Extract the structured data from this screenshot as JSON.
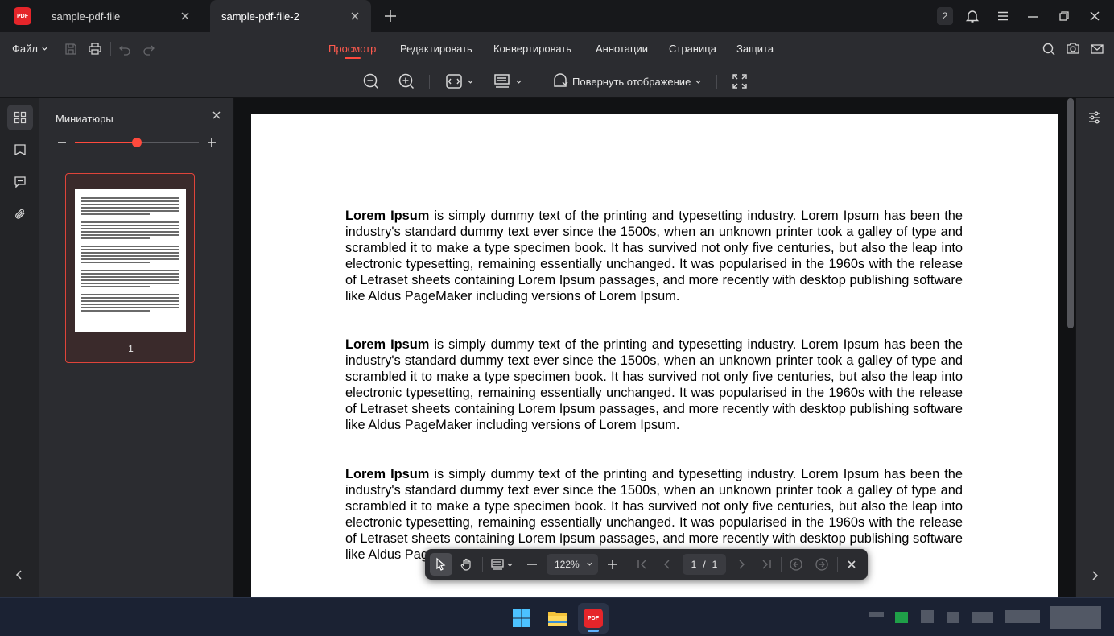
{
  "tabs": [
    {
      "label": "sample-pdf-file",
      "active": false
    },
    {
      "label": "sample-pdf-file-2",
      "active": true
    }
  ],
  "app_logo_text": "PDF",
  "notification_count": "2",
  "menu": {
    "file_label": "Файл",
    "tabs": [
      "Просмотр",
      "Редактировать",
      "Конвертировать",
      "Аннотации",
      "Страница",
      "Защита"
    ],
    "active_tab": "Просмотр"
  },
  "toolbar": {
    "rotate_label": "Повернуть отображение"
  },
  "thumbnails": {
    "title": "Миниатюры",
    "zoom_fraction": 0.5,
    "pages": [
      {
        "number": "1"
      }
    ]
  },
  "document": {
    "paragraphs": [
      {
        "bold": "Lorem Ipsum",
        "text": " is simply dummy text of the printing and typesetting industry. Lorem Ipsum has been the industry's standard dummy text ever since the 1500s, when an unknown printer took a galley of type and scrambled it to make a type specimen book. It has survived not only five centuries, but also the leap into electronic typesetting, remaining essentially unchanged. It was popularised in the 1960s with the release of Letraset sheets containing Lorem Ipsum passages, and more recently with desktop publishing software like Aldus PageMaker including versions of Lorem Ipsum."
      },
      {
        "bold": "Lorem Ipsum",
        "text": " is simply dummy text of the printing and typesetting industry. Lorem Ipsum has been the industry's standard dummy text ever since the 1500s, when an unknown printer took a galley of type and scrambled it to make a type specimen book. It has survived not only five centuries, but also the leap into electronic typesetting, remaining essentially unchanged. It was popularised in the 1960s with the release of Letraset sheets containing Lorem Ipsum passages, and more recently with desktop publishing software like Aldus PageMaker including versions of Lorem Ipsum."
      },
      {
        "bold": "Lorem Ipsum",
        "text": " is simply dummy text of the printing and typesetting industry. Lorem Ipsum has been the industry's standard dummy text ever since the 1500s, when an unknown printer took a galley of type and scrambled it to make a type specimen book. It has survived not only five centuries, but also the leap into electronic typesetting, remaining essentially unchanged. It was popularised in the 1960s with the release of Letraset sheets containing Lorem Ipsum passages, and more recently with desktop publishing software like Aldus PageMaker including versions of Lorem Ipsum."
      }
    ]
  },
  "floatbar": {
    "zoom": "122%",
    "current_page": "1",
    "page_separator": "/",
    "total_pages": "1"
  },
  "colors": {
    "accent": "#ff4a3d",
    "panel_bg": "#2b2c30",
    "doc_bg": "#111214",
    "titlebar_bg": "#17181b"
  },
  "icons": [
    "pdf-logo",
    "close-icon",
    "plus-icon",
    "bell-icon",
    "hamburger-icon",
    "minimize-icon",
    "restore-icon",
    "save-icon",
    "print-icon",
    "undo-icon",
    "redo-icon",
    "search-icon",
    "camera-icon",
    "mail-icon",
    "zoom-out-icon",
    "zoom-in-icon",
    "fit-width-icon",
    "page-display-icon",
    "rotate-view-icon",
    "fullscreen-icon",
    "thumbnails-icon",
    "bookmark-icon",
    "comment-icon",
    "attachment-icon",
    "settings-sliders-icon",
    "select-cursor-icon",
    "hand-icon",
    "first-page-icon",
    "prev-page-icon",
    "next-page-icon",
    "last-page-icon"
  ]
}
